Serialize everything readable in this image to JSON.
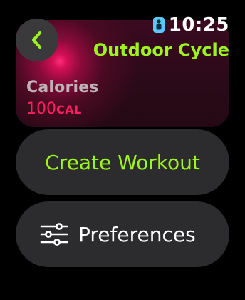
{
  "status_bar": {
    "time": "10:25",
    "workout_indicator_icon": "running-person-icon",
    "indicator_color": "#5ac8fa"
  },
  "header": {
    "title": "Outdoor Cycle",
    "back_icon": "chevron-left-icon"
  },
  "metric_card": {
    "label": "Calories",
    "value": "100",
    "unit": "CAL",
    "accent": "#ff1f5e"
  },
  "actions": {
    "create_workout_label": "Create Workout",
    "preferences_label": "Preferences",
    "preferences_icon": "sliders-icon"
  },
  "colors": {
    "accent_green": "#9cf51e",
    "pill_background": "#2c2c2e",
    "background": "#000000"
  }
}
